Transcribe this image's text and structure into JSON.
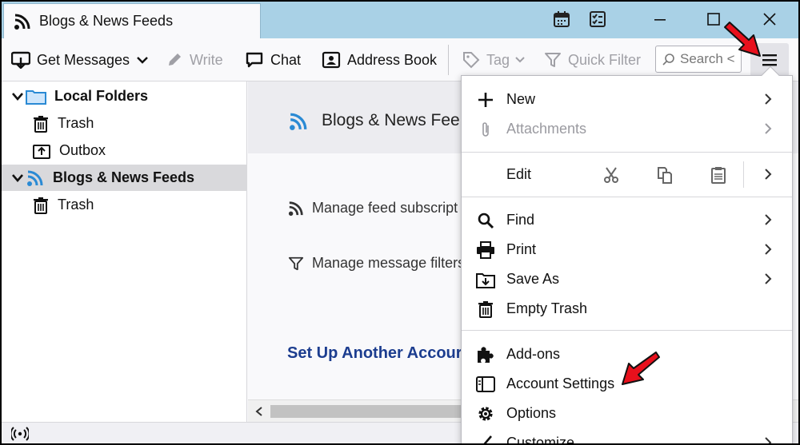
{
  "tab": {
    "title": "Blogs & News Feeds"
  },
  "toolbar": {
    "get_messages": "Get Messages",
    "write": "Write",
    "chat": "Chat",
    "address_book": "Address Book",
    "tag": "Tag",
    "quick_filter": "Quick Filter",
    "search_placeholder": "Search <"
  },
  "folders": [
    {
      "label": "Local Folders",
      "bold": true
    },
    {
      "label": "Trash"
    },
    {
      "label": "Outbox"
    },
    {
      "label": "Blogs & News Feeds",
      "bold": true
    },
    {
      "label": "Trash"
    }
  ],
  "content": {
    "account_title": "Blogs & News Fee",
    "manage_feeds": "Manage feed subscript",
    "manage_filters": "Manage message filters",
    "setup_title": "Set Up Another Accour"
  },
  "appmenu": {
    "new": "New",
    "attachments": "Attachments",
    "edit": "Edit",
    "find": "Find",
    "print": "Print",
    "save_as": "Save As",
    "empty_trash": "Empty Trash",
    "addons": "Add-ons",
    "account_settings": "Account Settings",
    "options": "Options",
    "customize": "Customize"
  },
  "colors": {
    "titlebar": "#a9d1e6",
    "accent_blue": "#2a8ad4",
    "link_blue": "#1c3d8f",
    "arrow_red": "#e8101c"
  }
}
